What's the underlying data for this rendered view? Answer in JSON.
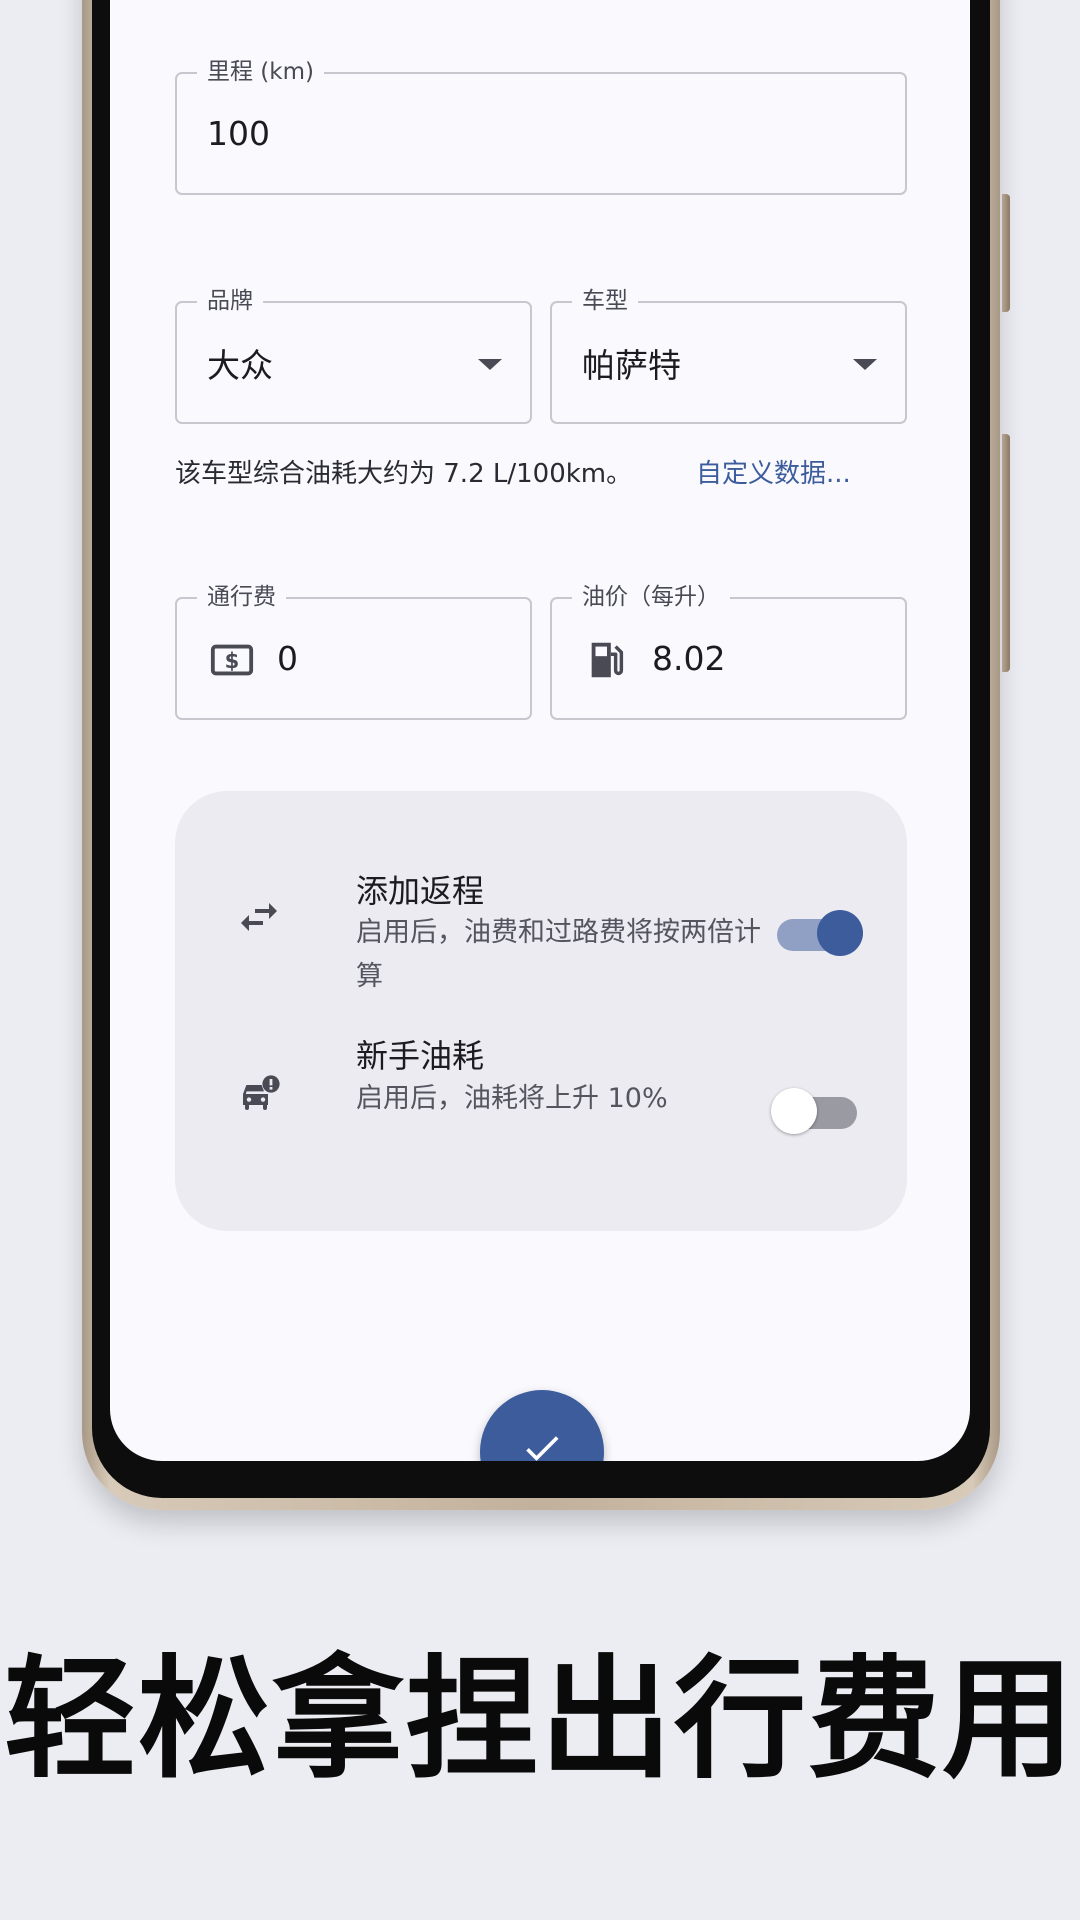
{
  "form": {
    "distance": {
      "label": "里程 (km)",
      "value": "100"
    },
    "brand": {
      "label": "品牌",
      "value": "大众"
    },
    "model": {
      "label": "车型",
      "value": "帕萨特"
    },
    "consumption_hint": "该车型综合油耗大约为 7.2 L/100km。",
    "custom_data_link": "自定义数据...",
    "toll": {
      "label": "通行费",
      "value": "0",
      "icon": "money-icon"
    },
    "fuel_price": {
      "label": "油价（每升）",
      "value": "8.02",
      "icon": "gas-station-icon"
    }
  },
  "settings": {
    "return_trip": {
      "title": "添加返程",
      "description": "启用后，油费和过路费将按两倍计算",
      "enabled": true,
      "icon": "swap-arrows-icon"
    },
    "novice_driver": {
      "title": "新手油耗",
      "description": "启用后，油耗将上升 10%",
      "enabled": false,
      "icon": "car-alert-icon"
    }
  },
  "fab": {
    "icon": "check-icon"
  },
  "colors": {
    "accent": "#3c5c9c",
    "screen_background": "#f9f9fe",
    "page_background": "#ecedf3"
  },
  "caption": "轻松拿捏出行费用"
}
